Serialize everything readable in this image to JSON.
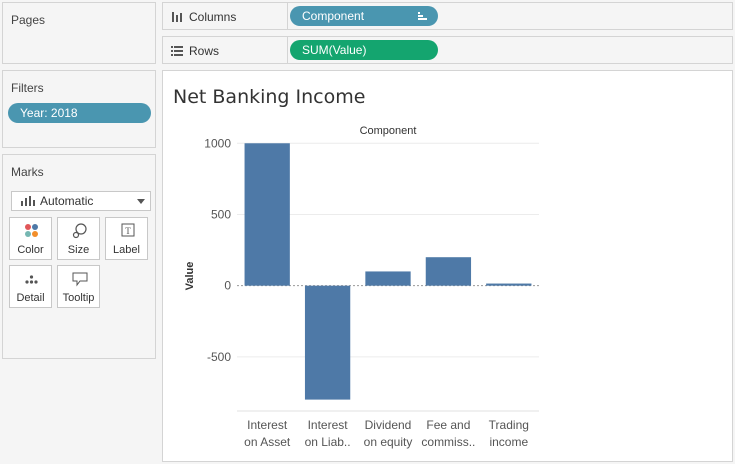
{
  "pages": {
    "title": "Pages"
  },
  "filters": {
    "title": "Filters",
    "pill": "Year: 2018"
  },
  "marks": {
    "title": "Marks",
    "type": "Automatic",
    "buttons": [
      "Color",
      "Size",
      "Label",
      "Detail",
      "Tooltip"
    ],
    "label_icon": "T"
  },
  "shelves": {
    "columns": {
      "label": "Columns",
      "pill": "Component"
    },
    "rows": {
      "label": "Rows",
      "pill": "SUM(Value)"
    }
  },
  "colors": {
    "bar": "#4e79a7",
    "pill_blue": "#4a96b0",
    "pill_green": "#14a56f"
  },
  "chart_data": {
    "type": "bar",
    "title": "Net Banking Income",
    "header": "Component",
    "ylabel": "Value",
    "categories": [
      [
        "Interest",
        "on Asset"
      ],
      [
        "Interest",
        "on Liab.."
      ],
      [
        "Dividend",
        "on equity"
      ],
      [
        "Fee and",
        "commiss.."
      ],
      [
        "Trading",
        "income"
      ]
    ],
    "values": [
      1000,
      -800,
      100,
      200,
      15
    ],
    "ylim": [
      -880,
      1030
    ],
    "yticks": [
      1000,
      500,
      0,
      -500
    ],
    "grid": true
  }
}
